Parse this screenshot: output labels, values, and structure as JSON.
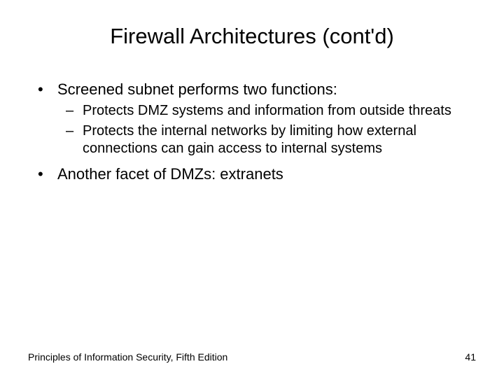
{
  "title": "Firewall Architectures (cont'd)",
  "bullets": {
    "b1": "Screened subnet performs two functions:",
    "b1_sub1": "Protects DMZ systems and information from outside threats",
    "b1_sub2": "Protects the internal networks by limiting how external connections can gain access to internal systems",
    "b2": "Another facet of DMZs: extranets"
  },
  "footer": {
    "left": "Principles of Information Security, Fifth Edition",
    "right": "41"
  }
}
